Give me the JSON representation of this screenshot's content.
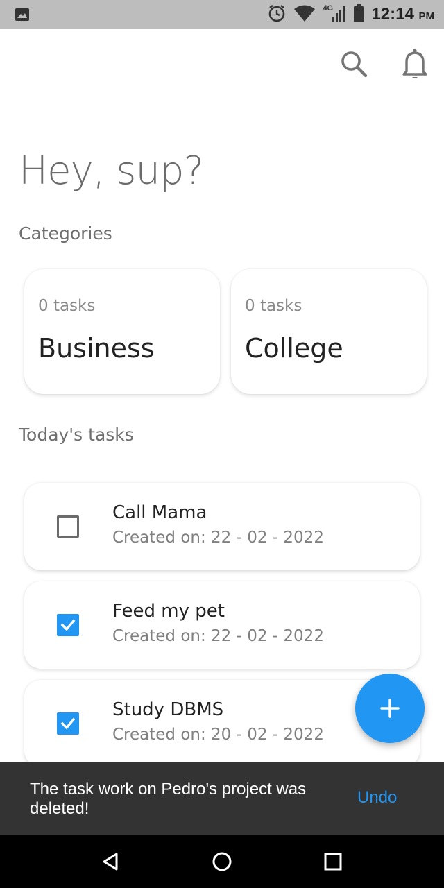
{
  "status_bar": {
    "time": "12:14",
    "ampm": "PM",
    "network": "4G",
    "icons": [
      "image-icon",
      "alarm-icon",
      "wifi-icon",
      "signal-icon",
      "battery-icon"
    ]
  },
  "header": {
    "icons": [
      "search-icon",
      "bell-icon"
    ]
  },
  "greeting": "Hey, sup?",
  "categories": {
    "label": "Categories",
    "items": [
      {
        "count": "0 tasks",
        "name": "Business"
      },
      {
        "count": "0 tasks",
        "name": "College"
      }
    ]
  },
  "tasks": {
    "label": "Today's tasks",
    "items": [
      {
        "title": "Call Mama",
        "created": "Created on: 22 - 02 - 2022",
        "checked": false
      },
      {
        "title": "Feed my pet",
        "created": "Created on: 22 - 02 - 2022",
        "checked": true
      },
      {
        "title": "Study DBMS",
        "created": "Created on: 20 - 02 - 2022",
        "checked": true
      }
    ]
  },
  "fab": {
    "icon": "plus-icon"
  },
  "snackbar": {
    "message": "The task work on Pedro's project was deleted!",
    "action": "Undo"
  },
  "colors": {
    "accent": "#2196f3",
    "snackbar_bg": "#333333",
    "status_bar_bg": "#bdbdbd"
  }
}
